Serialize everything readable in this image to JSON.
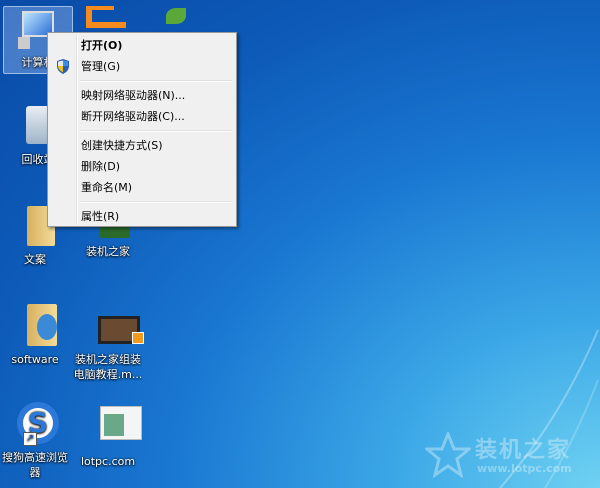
{
  "desktop": {
    "icons": [
      {
        "label": "计算机"
      },
      {
        "label": "回收站"
      },
      {
        "label": "文案"
      },
      {
        "label": "装机之家"
      },
      {
        "label": "software"
      },
      {
        "label": "装机之家组装电脑教程.m..."
      },
      {
        "label": "搜狗高速浏览器"
      },
      {
        "label": "lotpc.com"
      }
    ]
  },
  "context_menu": {
    "items": [
      {
        "label": "打开(O)"
      },
      {
        "label": "管理(G)",
        "icon": "uac-shield-icon"
      },
      {
        "label": "映射网络驱动器(N)..."
      },
      {
        "label": "断开网络驱动器(C)..."
      },
      {
        "label": "创建快捷方式(S)"
      },
      {
        "label": "删除(D)"
      },
      {
        "label": "重命名(M)"
      },
      {
        "label": "属性(R)"
      }
    ]
  },
  "watermark": {
    "title": "装机之家",
    "url": "www.lotpc.com"
  }
}
